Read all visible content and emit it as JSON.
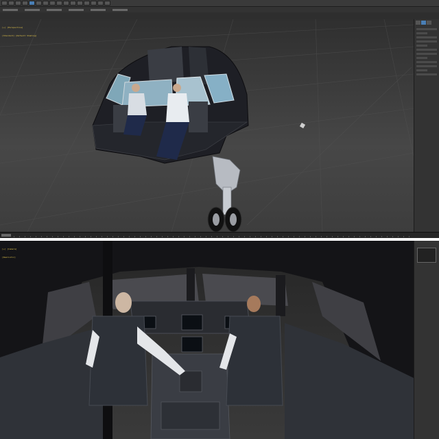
{
  "app": {
    "name": "3D modeling application",
    "accent": "#4a7fb5"
  },
  "top_screenshot": {
    "viewport": {
      "label_lines": [
        "[+] [Perspective]",
        "[Standard] [Default Shading]"
      ],
      "scene": "cockpit-nose-section-with-two-pilots-and-nose-landing-gear"
    },
    "command_panel": {
      "active_tab": "modify"
    }
  },
  "bottom_screenshot": {
    "viewport": {
      "label_lines": [
        "[+] [Camera]",
        "[Realistic]"
      ],
      "scene": "cockpit-interior-view-with-pilots-and-instrument-panel"
    }
  },
  "icons": {
    "toolbar": "toolbar-button-icon",
    "panel": "command-panel-tab-icon"
  },
  "colors": {
    "viewport_label": "#e0c34a",
    "ui_dark": "#2b2b2b",
    "panel": "#333333"
  }
}
